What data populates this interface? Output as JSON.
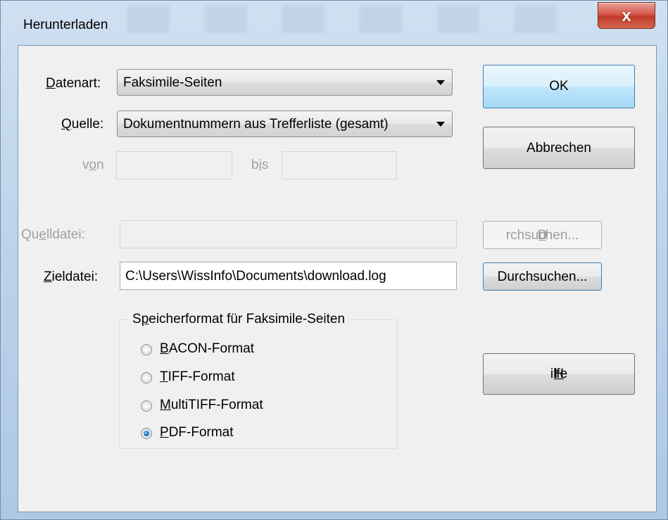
{
  "window": {
    "title": "Herunterladen",
    "close_symbol": "x"
  },
  "form": {
    "datenart": {
      "label_key": "D",
      "label_rest": "atenart:",
      "value": "Faksimile-Seiten"
    },
    "quelle": {
      "label_key": "Q",
      "label_rest": "uelle:",
      "value": "Dokumentnummern aus Trefferliste (gesamt)"
    },
    "von": {
      "label_pre": "v",
      "label_key": "o",
      "label_rest": "n",
      "value": ""
    },
    "bis": {
      "label_pre": "b",
      "label_key": "i",
      "label_rest": "s",
      "value": ""
    },
    "quelldatei": {
      "label_pre": "Qu",
      "label_key": "e",
      "label_rest": "lldatei:",
      "value": ""
    },
    "zieldatei": {
      "label_key": "Z",
      "label_rest": "ieldatei:",
      "value": "C:\\Users\\WissInfo\\Documents\\download.log"
    }
  },
  "buttons": {
    "ok": "OK",
    "cancel": "Abbrechen",
    "browse_source": {
      "pre": "D",
      "key": "u",
      "rest": "rchsuchen..."
    },
    "browse_target": "Durchsuchen...",
    "help": {
      "key": "H",
      "rest": "ilfe"
    }
  },
  "format_group": {
    "title_pre": "S",
    "title_key": "p",
    "title_rest": "eicherformat für Faksimile-Seiten",
    "options": [
      {
        "key": "B",
        "rest": "ACON-Format",
        "checked": false
      },
      {
        "key": "T",
        "rest": "IFF-Format",
        "checked": false
      },
      {
        "key": "M",
        "rest": "ultiTIFF-Format",
        "checked": false
      },
      {
        "key": "P",
        "rest": "DF-Format",
        "checked": true
      }
    ]
  }
}
